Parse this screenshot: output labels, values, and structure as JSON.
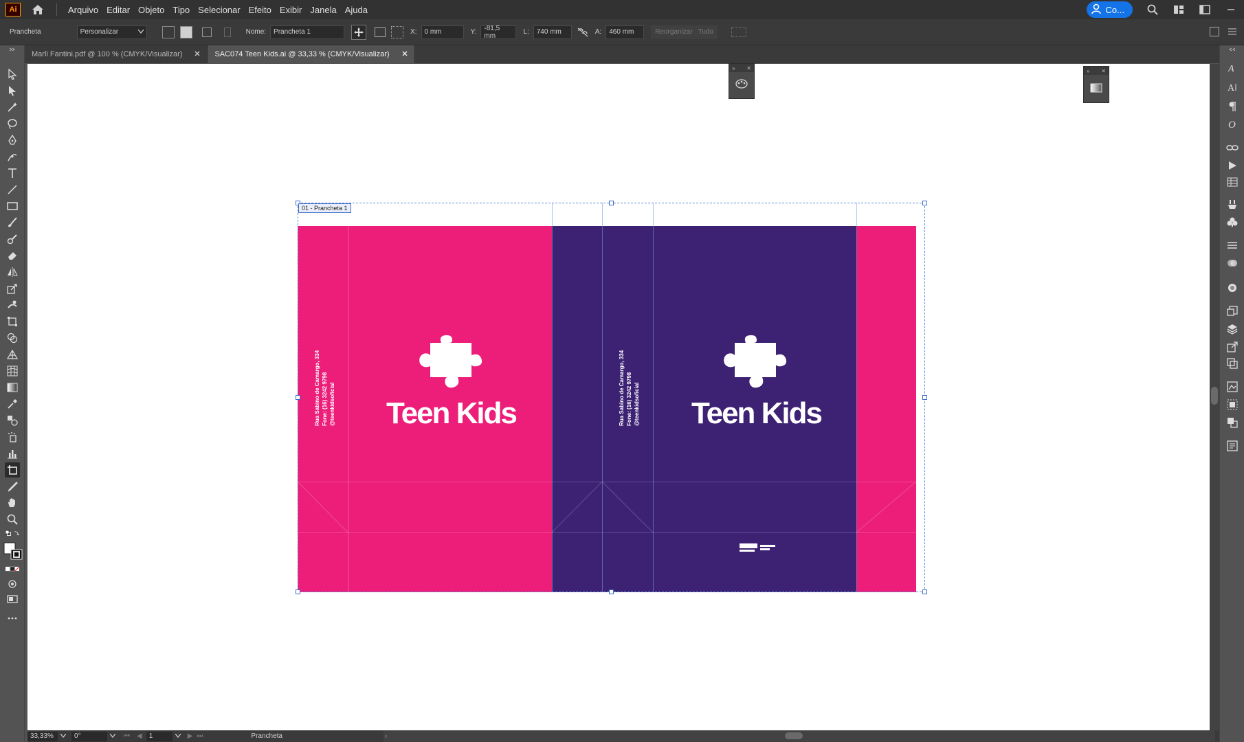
{
  "app": {
    "logo_text": "Ai",
    "menu": [
      "Arquivo",
      "Editar",
      "Objeto",
      "Tipo",
      "Selecionar",
      "Efeito",
      "Exibir",
      "Janela",
      "Ajuda"
    ],
    "cloud_label": "Co..."
  },
  "control_bar": {
    "context_label": "Prancheta",
    "preset_value": "Personalizar",
    "name_label": "Nome:",
    "name_value": "Prancheta 1",
    "x_label": "X:",
    "x_value": "0 mm",
    "y_label": "Y:",
    "y_value": "-81,5 mm",
    "w_label": "L:",
    "w_value": "740 mm",
    "h_label": "A:",
    "h_value": "460 mm",
    "rearrange_label": "Reorganizar",
    "all_label": "Tudo"
  },
  "tabs": [
    {
      "label": "Marli Fantini.pdf @ 100 % (CMYK/Visualizar)",
      "active": false
    },
    {
      "label": "SAC074 Teen Kids.ai @ 33,33 % (CMYK/Visualizar)",
      "active": true
    }
  ],
  "artboard": {
    "label": "01 - Prancheta 1",
    "brand_left": "Teen Kids",
    "brand_right": "Teen Kids",
    "address_line1": "Rua Sabino de Camargo, 334",
    "address_line2": "Fone: (16) 3242 9798",
    "address_line3": "@teenkidsoficial",
    "colors": {
      "pink": "#ec1e79",
      "purple": "#3d2274"
    }
  },
  "status_bar": {
    "zoom": "33,33%",
    "rotation": "0°",
    "artboard_number": "1",
    "tool_label": "Prancheta"
  }
}
